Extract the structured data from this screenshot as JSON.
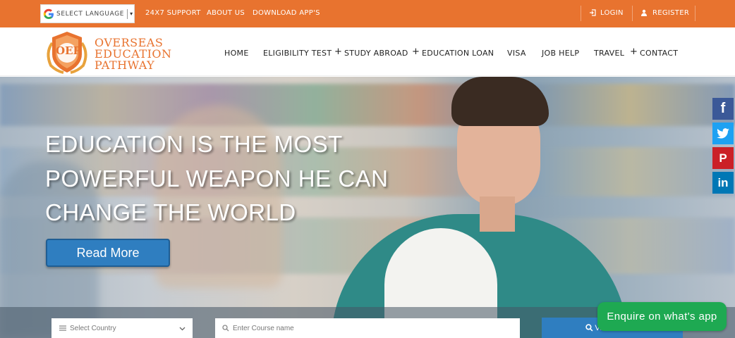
{
  "topbar": {
    "language_label": "SELECT LANGUAGE",
    "language_caret": "▾",
    "links": [
      "24X7 SUPPORT",
      "ABOUT US",
      "DOWNLOAD APP'S"
    ],
    "login": "LOGIN",
    "register": "REGISTER",
    "color": "#e8732f"
  },
  "logo": {
    "initials": "OEP",
    "line1": "OVERSEAS",
    "line2": "EDUCATION",
    "line3": "PATHWAY",
    "color": "#e8732f"
  },
  "nav": {
    "items": [
      "HOME",
      "ELIGIBILITY TEST",
      "STUDY ABROAD",
      "EDUCATION LOAN",
      "VISA",
      "JOB HELP",
      "TRAVEL",
      "CONTACT"
    ],
    "plus": "+"
  },
  "hero": {
    "headline_1": "EDUCATION IS THE MOST",
    "headline_2": "POWERFUL WEAPON HE CAN",
    "headline_3": "CHANGE THE WORLD",
    "read_more": "Read More"
  },
  "social": {
    "facebook": "f",
    "pinterest": "P",
    "linkedin": "in",
    "colors": {
      "facebook": "#3b5998",
      "twitter": "#1da1f2",
      "pinterest": "#cb2027",
      "linkedin": "#0077b5"
    }
  },
  "search": {
    "country_placeholder": "Select Country",
    "course_placeholder": "Enter Course name",
    "view_course": "View Course"
  },
  "whatsapp": {
    "label": "Enquire on what's app",
    "color": "#1ea952"
  }
}
